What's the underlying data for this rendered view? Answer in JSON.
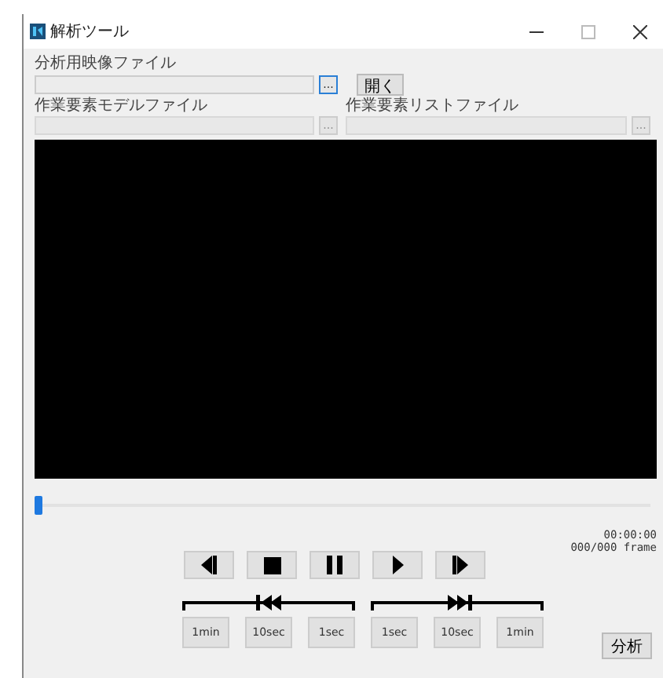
{
  "window": {
    "title": "解析ツール"
  },
  "video_file": {
    "label": "分析用映像ファイル",
    "browse": "...",
    "open_button": "開く",
    "disabled": false
  },
  "model_file": {
    "label": "作業要素モデルファイル",
    "browse": "...",
    "disabled": true
  },
  "list_file": {
    "label": "作業要素リストファイル",
    "browse": "...",
    "disabled": true
  },
  "seek": {
    "level": 0
  },
  "time": "00:00:00",
  "frame": "000/000 frame",
  "playback_buttons": [
    {
      "kind": "step-back"
    },
    {
      "kind": "stop"
    },
    {
      "kind": "pause"
    },
    {
      "kind": "play"
    },
    {
      "kind": "step-forward"
    }
  ],
  "rewind_buttons": [
    "1min",
    "10sec",
    "1sec"
  ],
  "forward_buttons": [
    "1sec",
    "10sec",
    "1min"
  ],
  "analyze_button": "分析"
}
